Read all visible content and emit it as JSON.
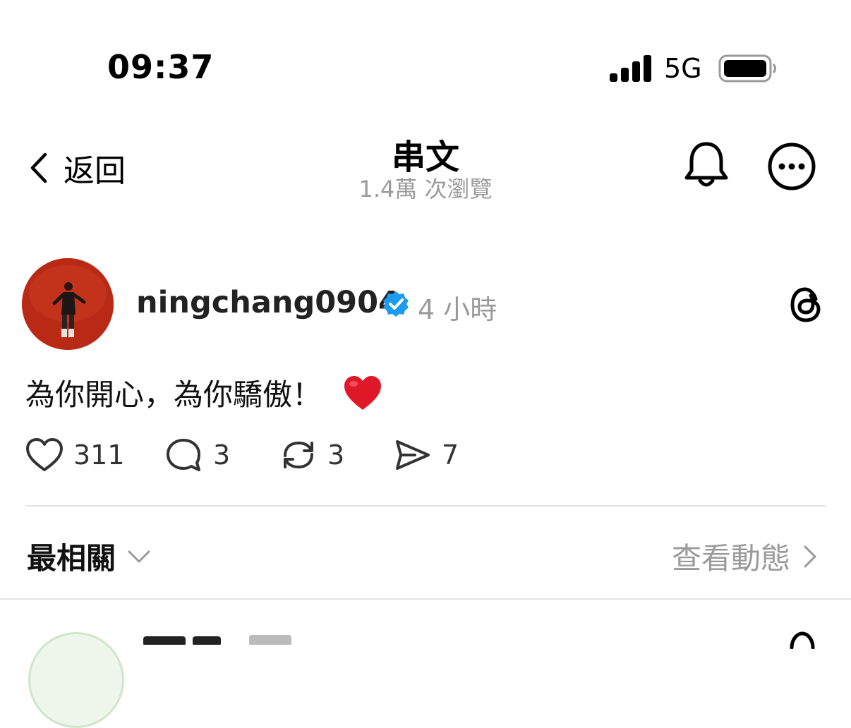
{
  "status_bar": {
    "time": "09:37",
    "network": "5G"
  },
  "header": {
    "back_label": "返回",
    "title": "串文",
    "views": "1.4萬 次瀏覽"
  },
  "post": {
    "username": "ningchang0904",
    "time_ago": "4 小時",
    "text": "為你開心，為你驕傲！",
    "likes": "311",
    "replies": "3",
    "reposts": "3",
    "shares": "7"
  },
  "replies_section": {
    "sort_label": "最相關",
    "activity_label": "查看動態"
  },
  "colors": {
    "verified": "#1d9bf0",
    "heart": "#e0192a",
    "muted": "#9a9a9a"
  },
  "icons": [
    "back-chevron-icon",
    "bell-icon",
    "more-icon",
    "verified-icon",
    "threads-logo-icon",
    "heart-icon",
    "comment-icon",
    "repost-icon",
    "share-icon",
    "chevron-down-icon",
    "chevron-right-icon"
  ]
}
